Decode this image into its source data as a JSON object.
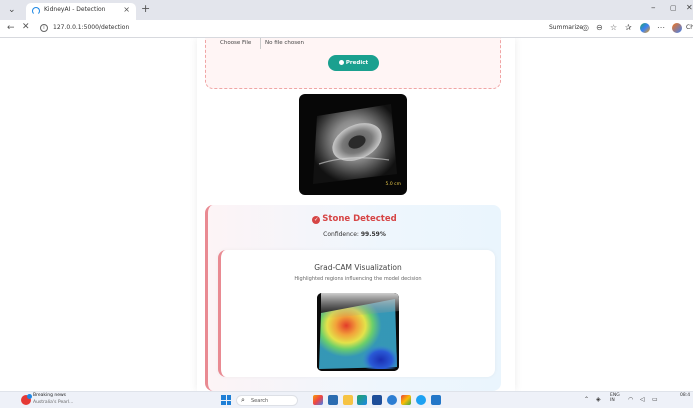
{
  "browser": {
    "tab_title": "KidneyAI - Detection",
    "tab_close": "×",
    "new_tab": "+",
    "url": "127.0.0.1:5000/detection",
    "summarize_label": "Summarize",
    "profile_text": "Ch",
    "icons": [
      "chevron-down-icon",
      "back-icon",
      "stop-icon",
      "info-icon",
      "zoom-icon",
      "star-icon",
      "favorites-icon",
      "copilot-icon",
      "more-icon",
      "profile-icon"
    ]
  },
  "page": {
    "upload": {
      "choose_file_label": "Choose File",
      "file_status": "No file chosen",
      "predict_label": "Predict"
    },
    "ultrasound_scale": "5.0 cm",
    "result": {
      "title": "Stone Detected",
      "confidence_label": "Confidence:",
      "confidence_value": "99.59%",
      "status_color": "#d64545"
    },
    "gradcam": {
      "title": "Grad-CAM Visualization",
      "subtitle": "Highlighted regions influencing the model decision"
    }
  },
  "taskbar": {
    "news_title": "Breaking news",
    "news_subtitle": "Australia's Pearl...",
    "search_label": "Search",
    "language": "ENG",
    "language_sub": "IN",
    "time": "08:4"
  }
}
